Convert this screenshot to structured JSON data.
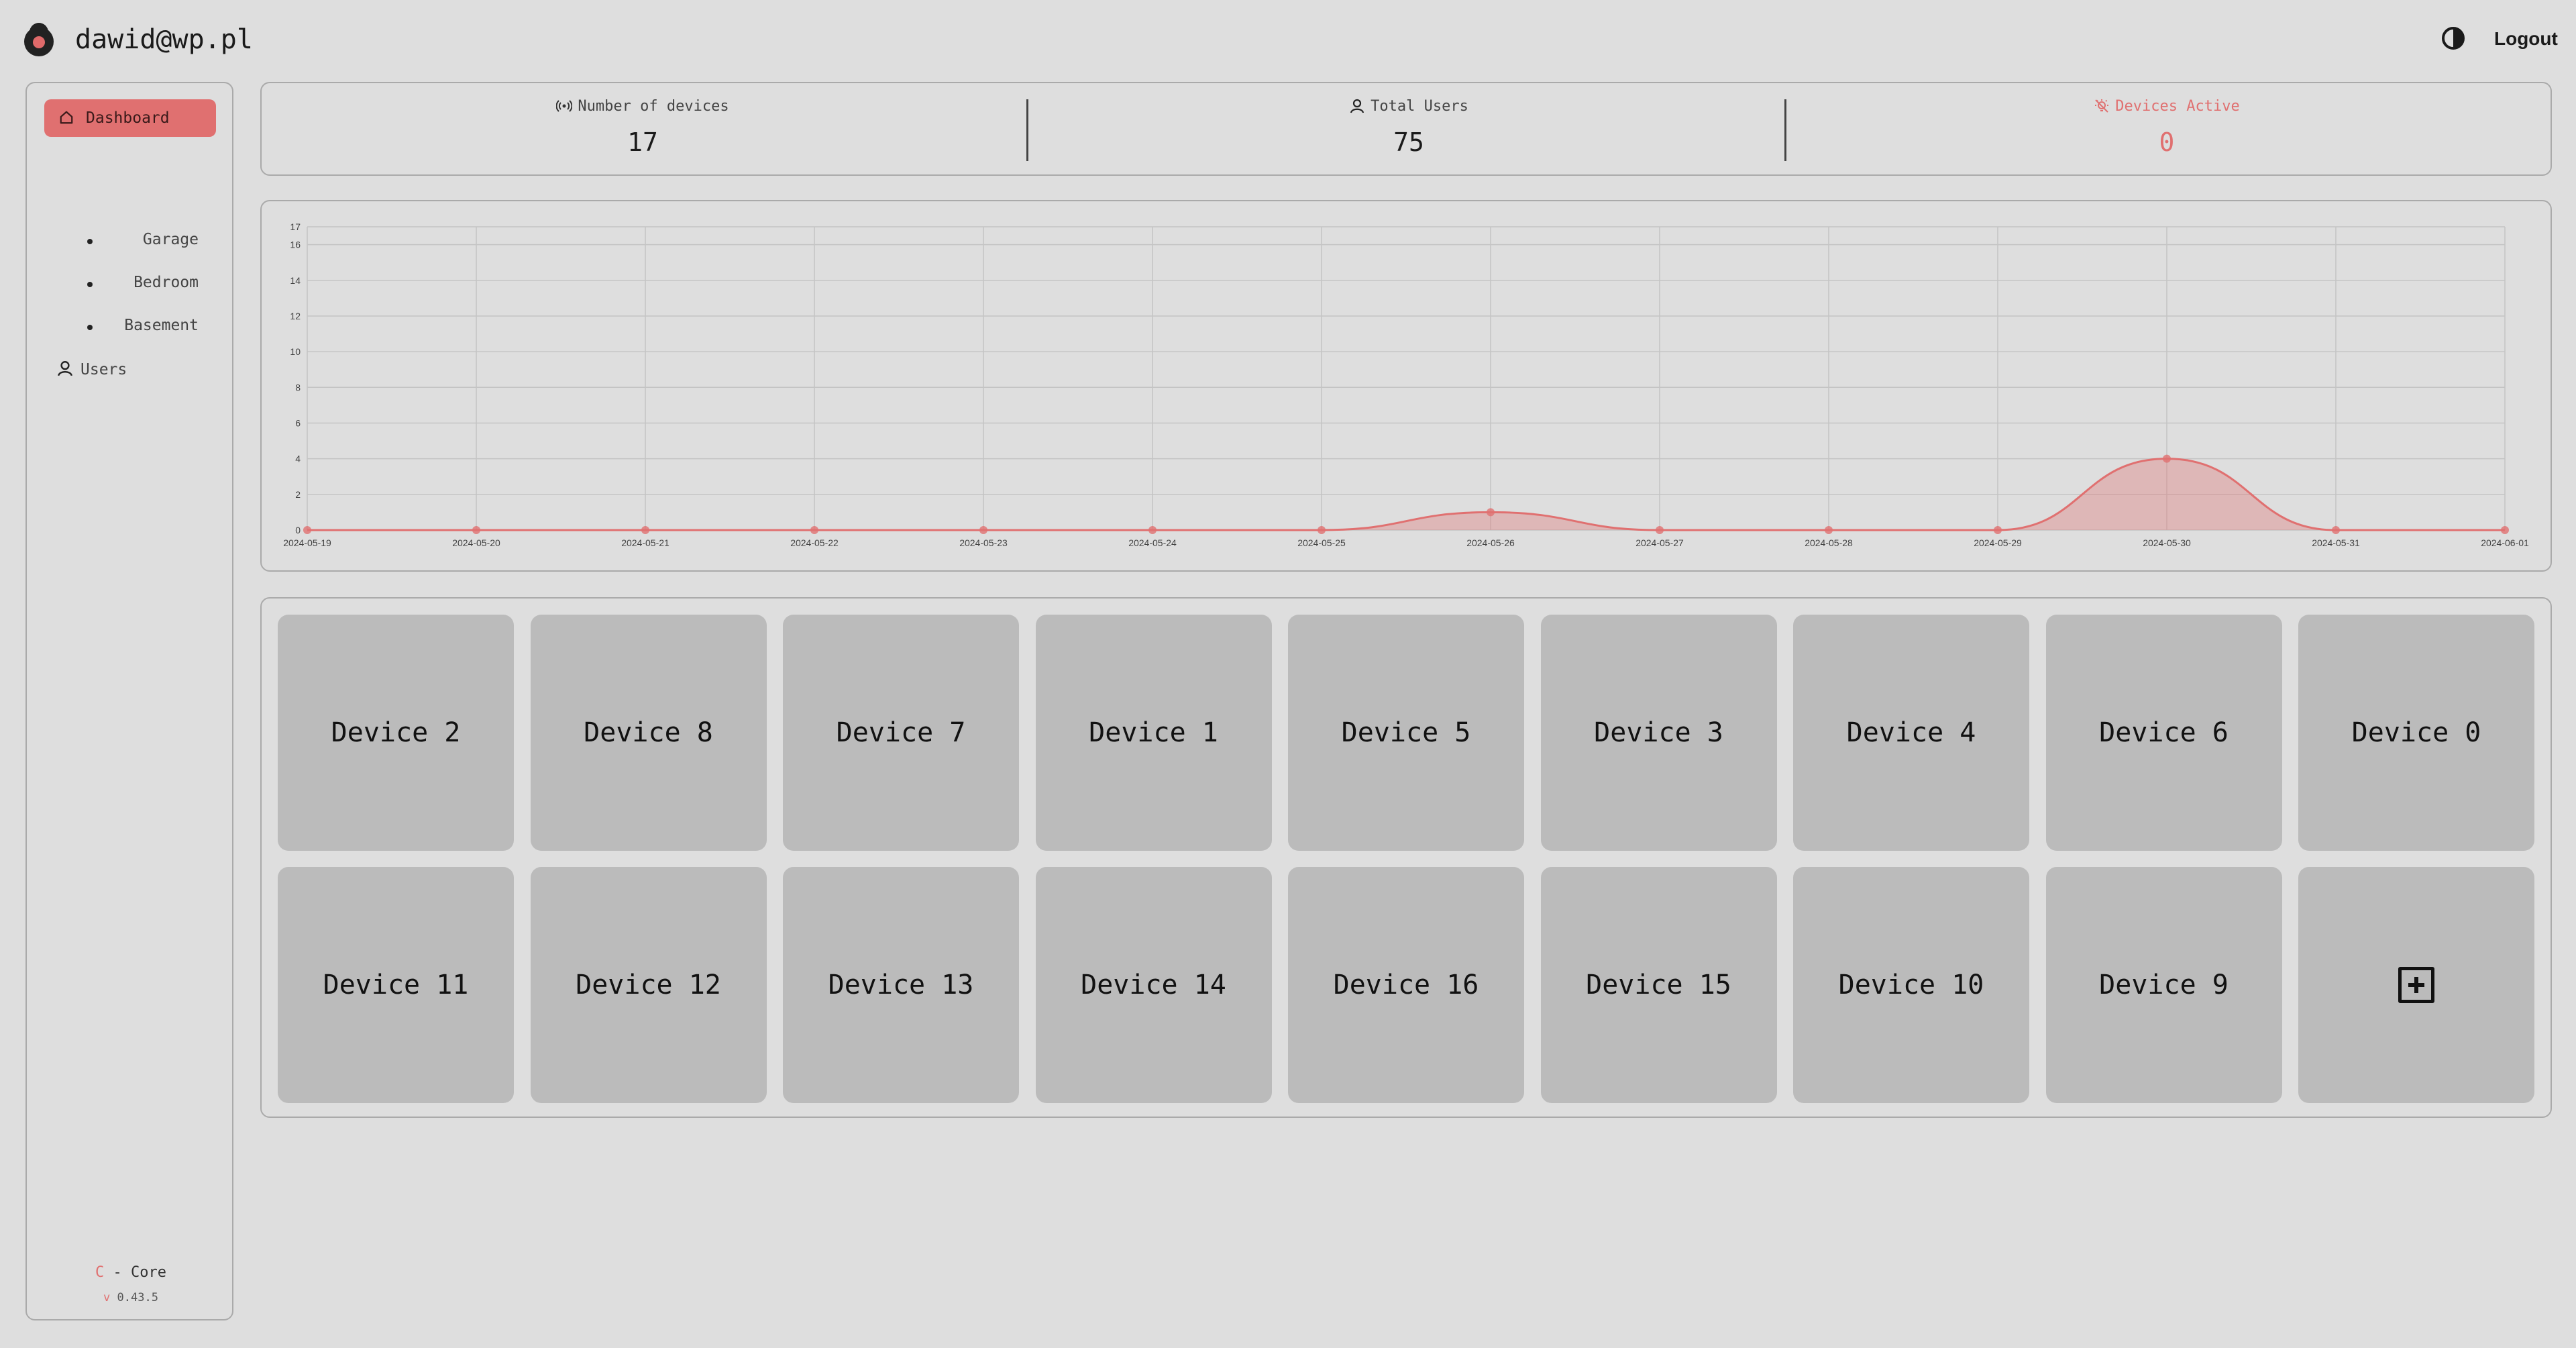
{
  "header": {
    "user_email": "dawid@wp.pl",
    "logout_label": "Logout"
  },
  "sidebar": {
    "dashboard_label": "Dashboard",
    "rooms": [
      "Garage",
      "Bedroom",
      "Basement"
    ],
    "users_label": "Users",
    "footer_letter": "C",
    "footer_name": " - Core",
    "footer_version_letter": "v",
    "footer_version": " 0.43.5"
  },
  "stats": [
    {
      "title": "Number of devices",
      "value": "17",
      "icon": "radio-signal-icon"
    },
    {
      "title": "Total Users",
      "value": "75",
      "icon": "user-icon"
    },
    {
      "title": "Devices Active",
      "value": "0",
      "icon": "bulb-off-icon"
    }
  ],
  "colors": {
    "accent": "#e07070",
    "tile": "#bbbbbb",
    "background": "#dedede"
  },
  "chart_data": {
    "type": "area",
    "x": [
      "2024-05-19",
      "2024-05-20",
      "2024-05-21",
      "2024-05-22",
      "2024-05-23",
      "2024-05-24",
      "2024-05-25",
      "2024-05-26",
      "2024-05-27",
      "2024-05-28",
      "2024-05-29",
      "2024-05-30",
      "2024-05-31",
      "2024-06-01"
    ],
    "values": [
      0,
      0,
      0,
      0,
      0,
      0,
      0,
      1,
      0,
      0,
      0,
      4,
      0,
      0
    ],
    "y_ticks": [
      "0",
      "2",
      "4",
      "6",
      "8",
      "10",
      "12",
      "14",
      "16",
      "17"
    ],
    "ylim": [
      0,
      17
    ],
    "grid": true,
    "color": "#e07070"
  },
  "devices": [
    "Device 2",
    "Device 8",
    "Device 7",
    "Device 1",
    "Device 5",
    "Device 3",
    "Device 4",
    "Device 6",
    "Device 0",
    "Device 11",
    "Device 12",
    "Device 13",
    "Device 14",
    "Device 16",
    "Device 15",
    "Device 10",
    "Device 9"
  ]
}
